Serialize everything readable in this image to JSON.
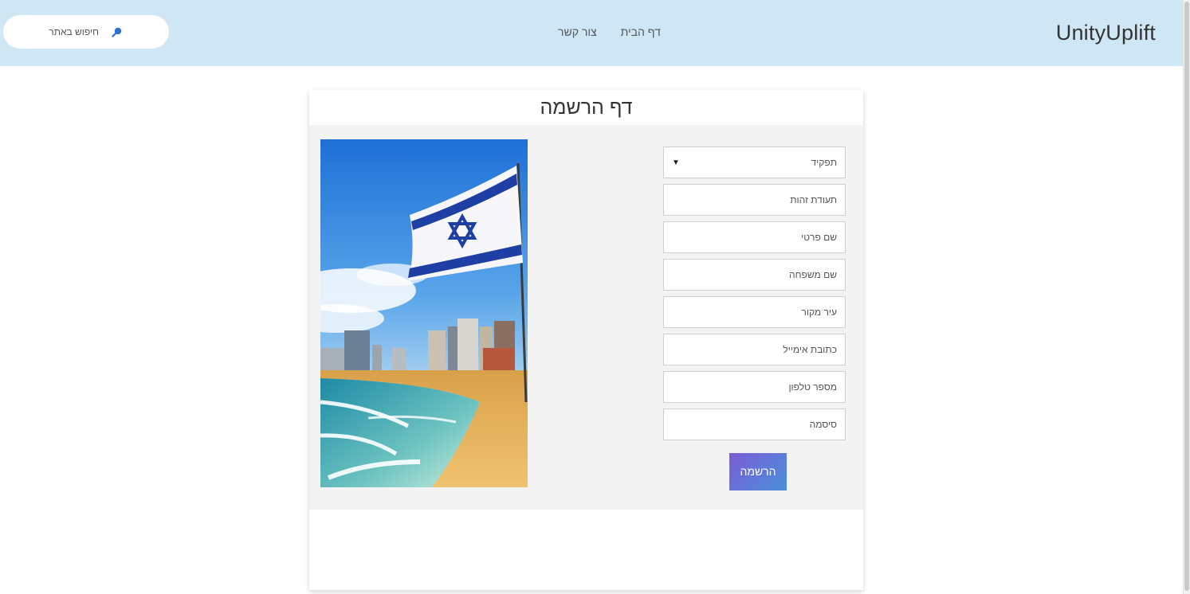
{
  "header": {
    "brand": "UnityUplift",
    "nav": [
      {
        "label": "דף הבית"
      },
      {
        "label": "צור קשר"
      }
    ],
    "search": {
      "placeholder": "חיפוש באתר",
      "icon": "search-icon"
    }
  },
  "page": {
    "title": "דף הרשמה"
  },
  "form": {
    "role_select": {
      "value": "תפקיד",
      "options": [
        "תפקיד"
      ]
    },
    "fields": [
      {
        "placeholder": "תעודת זהות"
      },
      {
        "placeholder": "שם פרטי"
      },
      {
        "placeholder": "שם משפחה"
      },
      {
        "placeholder": "עיר מקור"
      },
      {
        "placeholder": "כתובת אימייל"
      },
      {
        "placeholder": "מספר טלפון"
      },
      {
        "placeholder": "סיסמה"
      }
    ],
    "submit_label": "הרשמה"
  },
  "image": {
    "description_icon": "israel-flag-beach-image"
  },
  "colors": {
    "header_bg": "#cfe6f5",
    "button_gradient_start": "#7b5cd6",
    "button_gradient_end": "#4a90d9",
    "card_body_bg": "#f3f3f3"
  }
}
